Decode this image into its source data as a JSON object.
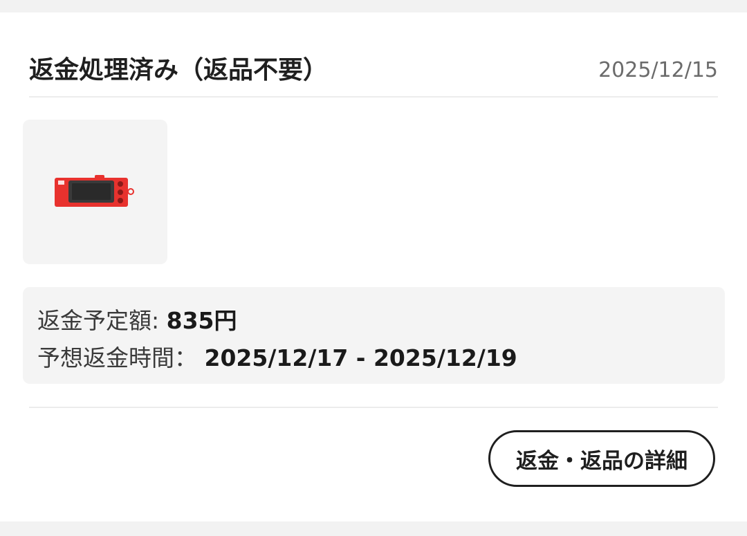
{
  "order": {
    "status_title": "返金処理済み（返品不要）",
    "date": "2025/12/15",
    "product_image": "red-camera-product-thumbnail",
    "refund_amount_label": "返金予定額: ",
    "refund_amount_value": "835円",
    "refund_time_label": "予想返金時間： ",
    "refund_time_value": "2025/12/17 - 2025/12/19",
    "detail_button_label": "返金・返品の詳細"
  },
  "colors": {
    "product_red": "#e8322e",
    "button_border": "#1f1f1f",
    "date_gray": "#6b6b6b"
  }
}
